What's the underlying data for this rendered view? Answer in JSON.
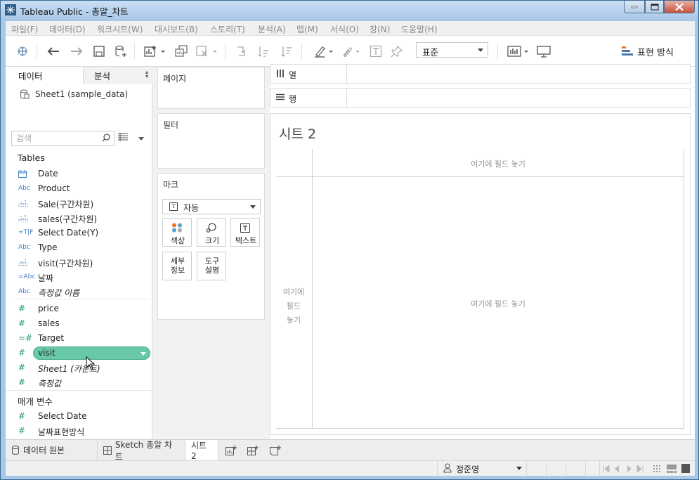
{
  "window": {
    "title": "Tableau Public - 총알_차트"
  },
  "menu": [
    "파일(F)",
    "데이터(D)",
    "워크시트(W)",
    "대시보드(B)",
    "스토리(T)",
    "분석(A)",
    "맵(M)",
    "서식(O)",
    "창(N)",
    "도움말(H)"
  ],
  "toolbar": {
    "icons": [
      "tableau-logo-icon",
      "undo-icon",
      "redo-icon",
      "save-icon",
      "new-datasource-icon",
      "new-worksheet-icon",
      "duplicate-icon",
      "clear-sheet-icon",
      "swap-icon",
      "sort-ascending-icon",
      "sort-descending-icon",
      "highlight-icon",
      "group-icon",
      "label-icon",
      "pin-icon",
      "show-cards-icon",
      "presentation-icon"
    ],
    "fit_value": "표준",
    "show_me_label": "표현 방식"
  },
  "data_pane": {
    "tabs": {
      "data": "데이터",
      "analysis": "분석"
    },
    "datasource": "Sheet1 (sample_data)",
    "search_placeholder": "검색",
    "tables_header": "Tables",
    "dimensions": [
      {
        "icon": "calendar",
        "type": "date",
        "label": "Date"
      },
      {
        "icon": "Abc",
        "type": "string",
        "label": "Product"
      },
      {
        "icon": "bin",
        "type": "bin",
        "label": "Sale(구간차원)"
      },
      {
        "icon": "bin",
        "type": "bin",
        "label": "sales(구간차원)"
      },
      {
        "icon": "=T|F",
        "type": "boolean-calc",
        "label": "Select Date(Y)"
      },
      {
        "icon": "Abc",
        "type": "string",
        "label": "Type"
      },
      {
        "icon": "bin",
        "type": "bin",
        "label": "visit(구간차원)"
      },
      {
        "icon": "=Abc",
        "type": "string-calc",
        "label": "날짜"
      },
      {
        "icon": "Abc",
        "type": "string",
        "label": "측정값 이름",
        "italic": true
      }
    ],
    "measures": [
      {
        "icon": "#",
        "label": "price"
      },
      {
        "icon": "#",
        "label": "sales"
      },
      {
        "icon": "=#",
        "label": "Target"
      },
      {
        "icon": "#",
        "label": "visit",
        "selected": true
      },
      {
        "icon": "#",
        "label": "Sheet1 (카운트)",
        "italic": true
      },
      {
        "icon": "#",
        "label": "측정값",
        "italic": true
      }
    ],
    "parameters_header": "매개 변수",
    "parameters": [
      {
        "icon": "#",
        "label": "Select Date"
      },
      {
        "icon": "#",
        "label": "날짜표현방식"
      }
    ]
  },
  "cards": {
    "pages": "페이지",
    "filters": "필터",
    "marks": "마크",
    "mark_type": "자동",
    "mark_buttons": [
      {
        "label": "색상",
        "icon": "color-icon"
      },
      {
        "label": "크기",
        "icon": "size-icon"
      },
      {
        "label": "텍스트",
        "icon": "text-icon"
      },
      {
        "label": "세부\n정보",
        "icon": "detail-icon"
      },
      {
        "label": "도구\n설명",
        "icon": "tooltip-icon"
      }
    ]
  },
  "shelves": {
    "columns": "열",
    "rows": "행"
  },
  "sheet": {
    "title": "시트 2",
    "drop_top": "여기에 필드 놓기",
    "drop_center": "여기에 필드 놓기",
    "drop_left": "여기에\n필드\n놓기"
  },
  "sheet_tabs": [
    {
      "label": "데이터 원본",
      "icon": "datasource-icon"
    },
    {
      "label": "Sketch 총알 차트",
      "icon": "dashboard-icon"
    },
    {
      "label": "시트 2",
      "icon": "",
      "active": true
    }
  ],
  "status": {
    "user": "정준영"
  }
}
